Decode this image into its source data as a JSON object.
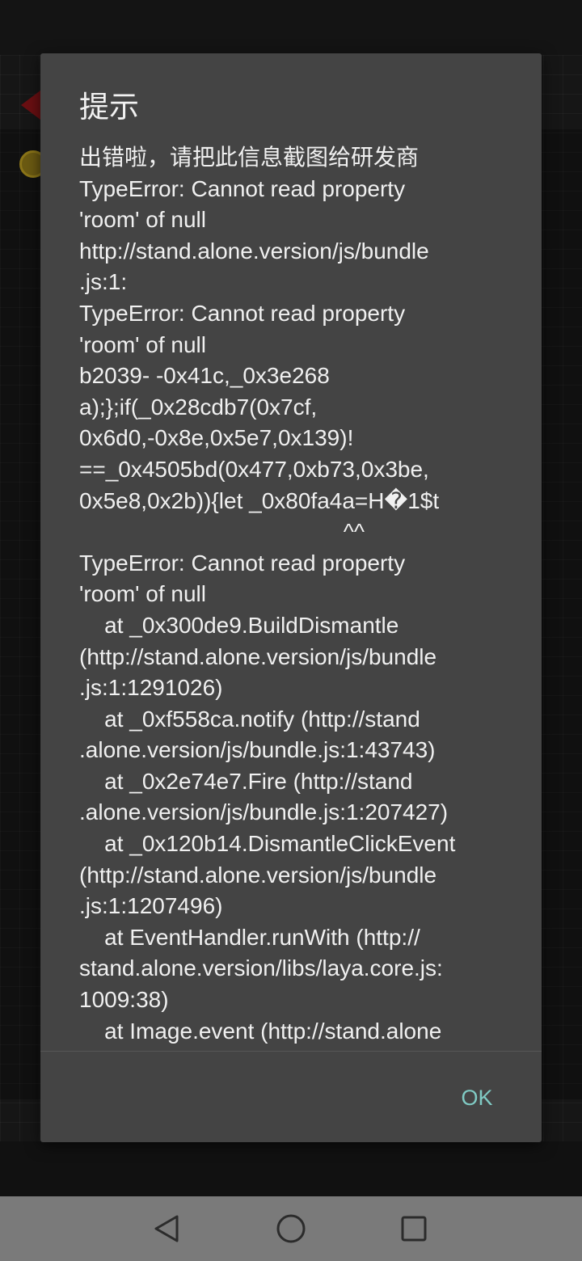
{
  "dialog": {
    "title": "提示",
    "message_lines": [
      "出错啦，请把此信息截图给研发商",
      "TypeError: Cannot read property",
      "'room' of null",
      "http://stand.alone.version/js/bundle",
      ".js:1:",
      "TypeError: Cannot read property",
      "'room' of null",
      "b2039- -0x41c,_0x3e268",
      "a);};if(_0x28cdb7(0x7cf,",
      "0x6d0,-0x8e,0x5e7,0x139)!",
      "==_0x4505bd(0x477,0xb73,0x3be,",
      "0x5e8,0x2b)){let _0x80fa4a=H�1$t",
      "                                          ^^",
      "TypeError: Cannot read property",
      "'room' of null",
      "    at _0x300de9.BuildDismantle",
      "(http://stand.alone.version/js/bundle",
      ".js:1:1291026)",
      "    at _0xf558ca.notify (http://stand",
      ".alone.version/js/bundle.js:1:43743)",
      "    at _0x2e74e7.Fire (http://stand",
      ".alone.version/js/bundle.js:1:207427)",
      "    at _0x120b14.DismantleClickEvent",
      "(http://stand.alone.version/js/bundle",
      ".js:1:1207496)",
      "    at EventHandler.runWith (http://",
      "stand.alone.version/libs/laya.core.js:",
      "1009:38)",
      "    at Image.event (http://stand.alone"
    ],
    "ok_label": "OK"
  },
  "nav_bar": {
    "back_icon": "triangle-back-icon",
    "home_icon": "circle-home-icon",
    "recent_icon": "square-recents-icon"
  },
  "colors": {
    "dialog_bg": "#444444",
    "text": "#f0f0f0",
    "accent": "#80cbc4",
    "nav_bar": "#7a7a7a"
  }
}
